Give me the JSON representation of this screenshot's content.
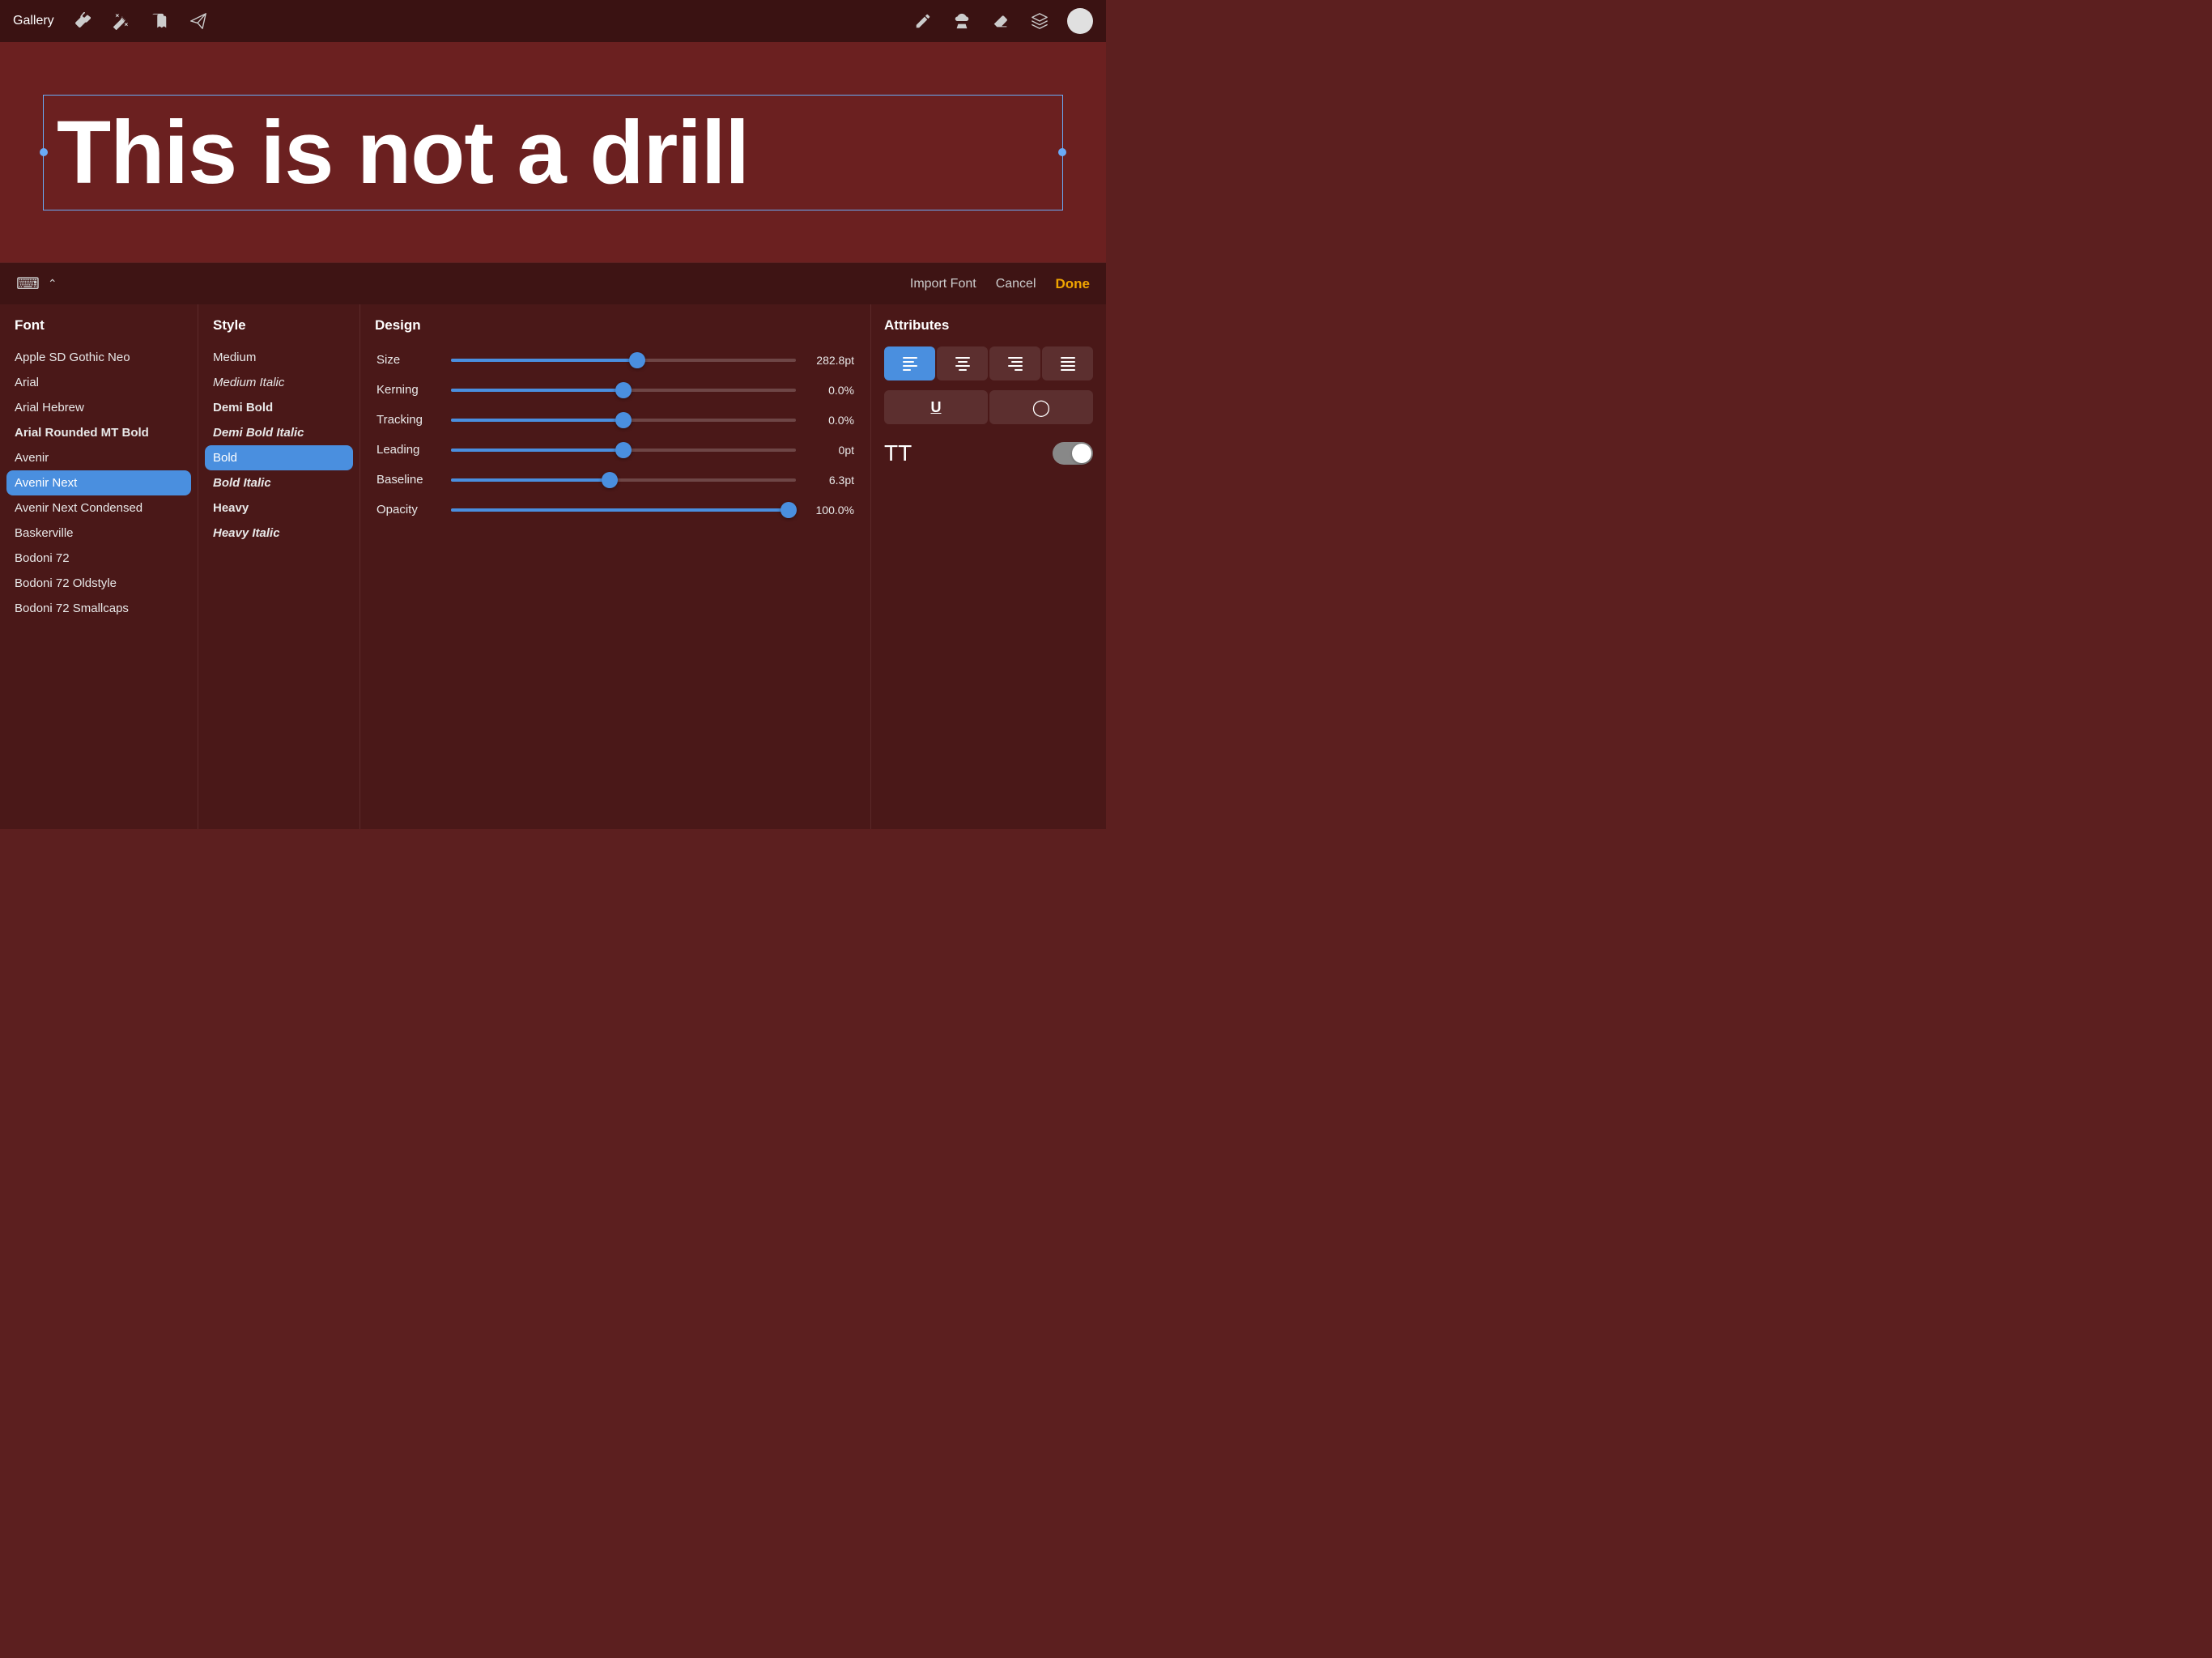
{
  "toolbar": {
    "gallery_label": "Gallery",
    "import_label": "Import Font",
    "cancel_label": "Cancel",
    "done_label": "Done"
  },
  "canvas": {
    "main_text": "This is not a drill"
  },
  "font_panel": {
    "header": "Font",
    "items": [
      {
        "name": "Apple SD Gothic Neo",
        "bold": false,
        "selected": false
      },
      {
        "name": "Arial",
        "bold": false,
        "selected": false
      },
      {
        "name": "Arial Hebrew",
        "bold": false,
        "selected": false
      },
      {
        "name": "Arial Rounded MT Bold",
        "bold": true,
        "selected": false
      },
      {
        "name": "Avenir",
        "bold": false,
        "selected": false
      },
      {
        "name": "Avenir Next",
        "bold": false,
        "selected": true
      },
      {
        "name": "Avenir Next Condensed",
        "bold": false,
        "selected": false
      },
      {
        "name": "Baskerville",
        "bold": false,
        "selected": false
      },
      {
        "name": "Bodoni 72",
        "bold": false,
        "selected": false
      },
      {
        "name": "Bodoni 72 Oldstyle",
        "bold": false,
        "selected": false
      },
      {
        "name": "Bodoni 72 Smallcaps",
        "bold": false,
        "selected": false
      }
    ]
  },
  "style_panel": {
    "header": "Style",
    "items": [
      {
        "name": "Medium",
        "italic": false,
        "bold": false,
        "selected": false
      },
      {
        "name": "Medium Italic",
        "italic": true,
        "bold": false,
        "selected": false
      },
      {
        "name": "Demi Bold",
        "italic": false,
        "bold": true,
        "selected": false
      },
      {
        "name": "Demi Bold Italic",
        "italic": true,
        "bold": true,
        "selected": false
      },
      {
        "name": "Bold",
        "italic": false,
        "bold": false,
        "selected": true
      },
      {
        "name": "Bold Italic",
        "italic": true,
        "bold": true,
        "selected": false
      },
      {
        "name": "Heavy",
        "italic": false,
        "bold": true,
        "selected": false
      },
      {
        "name": "Heavy Italic",
        "italic": true,
        "bold": true,
        "selected": false
      }
    ]
  },
  "design_panel": {
    "header": "Design",
    "rows": [
      {
        "label": "Size",
        "fill_pct": 54,
        "thumb_pct": 54,
        "value": "282.8pt"
      },
      {
        "label": "Kerning",
        "fill_pct": 50,
        "thumb_pct": 50,
        "value": "0.0%"
      },
      {
        "label": "Tracking",
        "fill_pct": 50,
        "thumb_pct": 50,
        "value": "0.0%"
      },
      {
        "label": "Leading",
        "fill_pct": 50,
        "thumb_pct": 50,
        "value": "0pt"
      },
      {
        "label": "Baseline",
        "fill_pct": 46,
        "thumb_pct": 46,
        "value": "6.3pt"
      },
      {
        "label": "Opacity",
        "fill_pct": 98,
        "thumb_pct": 98,
        "value": "100.0%"
      }
    ]
  },
  "attributes_panel": {
    "header": "Attributes",
    "align_buttons": [
      {
        "id": "align-left",
        "active": true
      },
      {
        "id": "align-center",
        "active": false
      },
      {
        "id": "align-right",
        "active": false
      },
      {
        "id": "align-justify",
        "active": false
      }
    ],
    "format_buttons": [
      {
        "id": "underline",
        "label": "U",
        "active": false
      },
      {
        "id": "outline",
        "label": "○",
        "active": false
      }
    ],
    "tt_label": "TT",
    "toggle_on": false
  }
}
